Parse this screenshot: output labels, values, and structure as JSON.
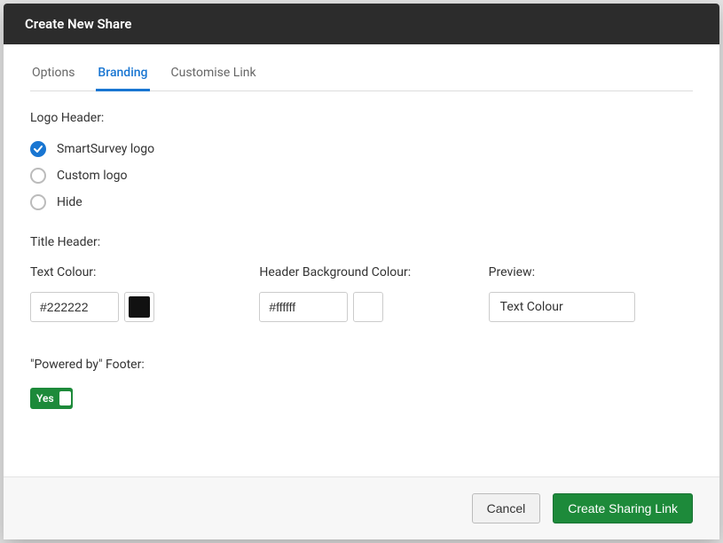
{
  "modal": {
    "title": "Create New Share"
  },
  "tabs": {
    "options": "Options",
    "branding": "Branding",
    "customise": "Customise Link"
  },
  "branding": {
    "logo_header_label": "Logo Header:",
    "radios": {
      "smartsurvey": "SmartSurvey logo",
      "custom": "Custom logo",
      "hide": "Hide"
    },
    "title_header_label": "Title Header:",
    "text_colour_label": "Text Colour:",
    "text_colour_value": "#222222",
    "text_colour_swatch": "#111111",
    "header_bg_label": "Header Background Colour:",
    "header_bg_value": "#ffffff",
    "header_bg_swatch": "#ffffff",
    "preview_label": "Preview:",
    "preview_text": "Text Colour",
    "footer_label": "\"Powered by\" Footer:",
    "footer_toggle_text": "Yes"
  },
  "footer": {
    "cancel": "Cancel",
    "create": "Create Sharing Link"
  }
}
